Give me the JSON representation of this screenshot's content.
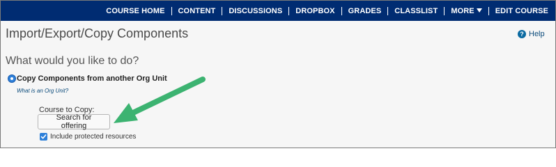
{
  "navbar": {
    "items": [
      {
        "label": "COURSE HOME"
      },
      {
        "label": "CONTENT"
      },
      {
        "label": "DISCUSSIONS"
      },
      {
        "label": "DROPBOX"
      },
      {
        "label": "GRADES"
      },
      {
        "label": "CLASSLIST"
      },
      {
        "label": "MORE"
      },
      {
        "label": "EDIT COURSE"
      }
    ]
  },
  "page": {
    "title": "Import/Export/Copy Components",
    "help_label": "Help",
    "help_icon_glyph": "?"
  },
  "form": {
    "question": "What would you like to do?",
    "option_label": "Copy Components from another Org Unit",
    "orgunit_link": "What is an Org Unit?",
    "course_to_copy_label": "Course to Copy:",
    "search_button_label": "Search for offering",
    "protected_checkbox_label": "Include protected resources",
    "protected_checked": true,
    "option_selected": true
  },
  "colors": {
    "navbar": "#002c72",
    "accent_blue": "#2d7fd9",
    "annotation_arrow": "#3cb371"
  }
}
